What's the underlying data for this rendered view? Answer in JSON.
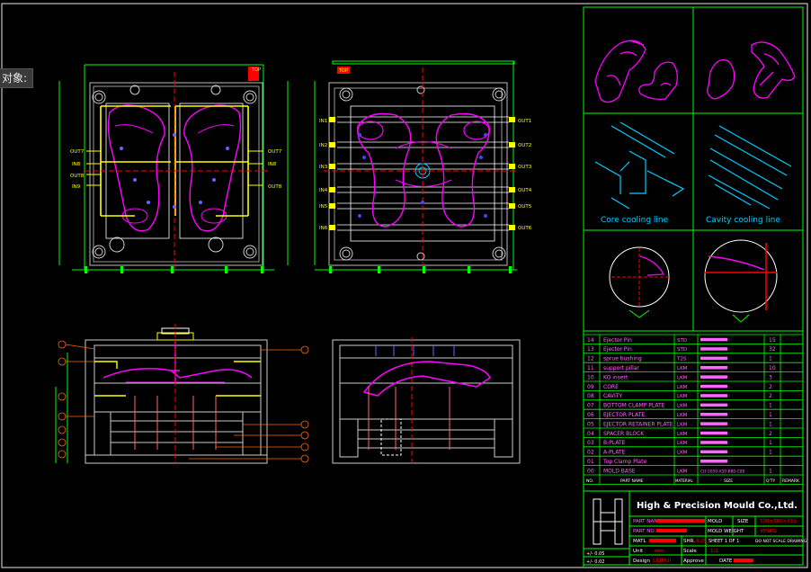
{
  "tooltip": "对象:",
  "labels": {
    "top": "TOP",
    "out7": "OUT7",
    "in8": "IN8",
    "out8": "OUT8",
    "in9": "IN9",
    "out1": "OUT1",
    "out2": "OUT2",
    "out3": "OUT3",
    "out4": "OUT4",
    "out5": "OUT5",
    "out6": "OUT6",
    "in1": "IN1",
    "in2": "IN2",
    "in3": "IN3",
    "in4": "IN4",
    "in5": "IN5",
    "in6": "IN6",
    "core_cooling": "Core cooling line",
    "cavity_cooling": "Cavity cooling line"
  },
  "bom": [
    {
      "no": "14",
      "name": "Ejector Pin",
      "mat": "STD",
      "spec": "",
      "qty": "15"
    },
    {
      "no": "13",
      "name": "Ejector Pin",
      "mat": "STD",
      "spec": "",
      "qty": "32"
    },
    {
      "no": "12",
      "name": "sprue bushing",
      "mat": "T2S",
      "spec": "",
      "qty": "1"
    },
    {
      "no": "11",
      "name": "support pillar",
      "mat": "LKM",
      "spec": "",
      "qty": "10"
    },
    {
      "no": "10",
      "name": "KO insert",
      "mat": "LKM",
      "spec": "",
      "qty": "3"
    },
    {
      "no": "09",
      "name": "CORE",
      "mat": "LKM",
      "spec": "",
      "qty": "2"
    },
    {
      "no": "08",
      "name": "CAVITY",
      "mat": "LKM",
      "spec": "",
      "qty": "2"
    },
    {
      "no": "07",
      "name": "BOTTOM CLAMP PLATE",
      "mat": "LKM",
      "spec": "",
      "qty": "1"
    },
    {
      "no": "06",
      "name": "EJECTOR PLATE",
      "mat": "LKM",
      "spec": "",
      "qty": "1"
    },
    {
      "no": "05",
      "name": "EJECTOR RETAINER PLATE",
      "mat": "LKM",
      "spec": "",
      "qty": "1"
    },
    {
      "no": "04",
      "name": "SPACER BLOCK",
      "mat": "LKM",
      "spec": "",
      "qty": "2"
    },
    {
      "no": "03",
      "name": "B-PLATE",
      "mat": "LKM",
      "spec": "",
      "qty": "1"
    },
    {
      "no": "02",
      "name": "A-PLATE",
      "mat": "LKM",
      "spec": "",
      "qty": "1"
    },
    {
      "no": "01",
      "name": "Top Clamp Plate",
      "mat": "",
      "spec": "",
      "qty": ""
    },
    {
      "no": "00",
      "name": "MOLD BASE",
      "mat": "LKM",
      "spec": "CH-5050-A50-B80-C80",
      "qty": "1"
    }
  ],
  "bom_header": {
    "no": "NO.",
    "name": "PART NAME",
    "mat": "MATERIAL",
    "spec": "SIZE",
    "qty": "Q'TY",
    "remark": "REMARK"
  },
  "title_block": {
    "company": "High & Precision Mould Co.,Ltd.",
    "part_name": "PART NAME",
    "part_no": "PART NO.",
    "material": "MATL",
    "mold": "MOLD",
    "size": "SIZE",
    "size_value": "500×500×331",
    "mold_weight": "MOLD WEIGHT",
    "weight_value": "455KG",
    "shrinkage": "SHR.",
    "shrinkage_value": "0.05",
    "sheet": "SHEET 1 OF 1",
    "do_not_scale": "DO NOT SCALE DRAWING",
    "units": "Unit",
    "units_value": "mm",
    "scale": "Scale",
    "scale_value": "1:1",
    "design": "Design",
    "design_value": "LIUHUI",
    "approve": "Approve",
    "date": "DATE",
    "tol1": "+/- 0.05",
    "tol2": "+/- 0.02"
  }
}
